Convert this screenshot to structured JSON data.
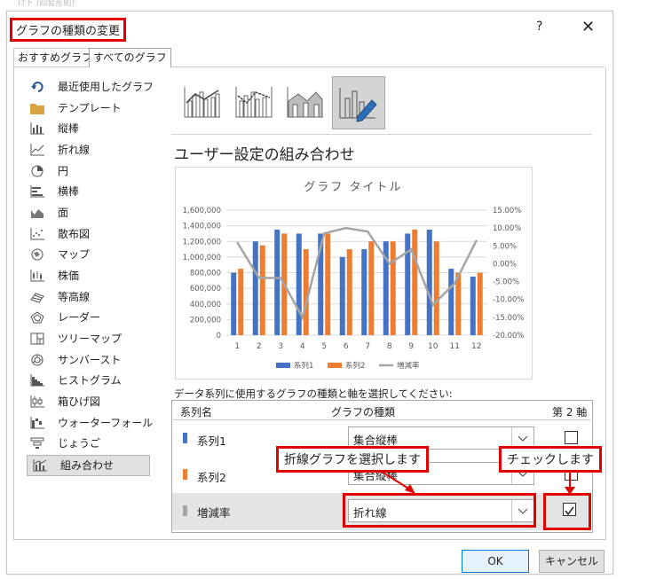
{
  "window": {
    "title": "グラフの種類の変更",
    "help": "?",
    "close": "✕"
  },
  "tabs": [
    {
      "label": "おすすめグラフ"
    },
    {
      "label": "すべてのグラフ"
    }
  ],
  "sidebar": {
    "items": [
      {
        "label": "最近使用したグラフ",
        "icon": "undo-icon"
      },
      {
        "label": "テンプレート",
        "icon": "folder-icon"
      },
      {
        "label": "縦棒",
        "icon": "column-chart-icon"
      },
      {
        "label": "折れ線",
        "icon": "line-chart-icon"
      },
      {
        "label": "円",
        "icon": "pie-chart-icon"
      },
      {
        "label": "横棒",
        "icon": "bar-chart-icon"
      },
      {
        "label": "面",
        "icon": "area-chart-icon"
      },
      {
        "label": "散布図",
        "icon": "scatter-chart-icon"
      },
      {
        "label": "マップ",
        "icon": "map-chart-icon"
      },
      {
        "label": "株価",
        "icon": "stock-chart-icon"
      },
      {
        "label": "等高線",
        "icon": "surface-chart-icon"
      },
      {
        "label": "レーダー",
        "icon": "radar-chart-icon"
      },
      {
        "label": "ツリーマップ",
        "icon": "treemap-chart-icon"
      },
      {
        "label": "サンバースト",
        "icon": "sunburst-chart-icon"
      },
      {
        "label": "ヒストグラム",
        "icon": "histogram-chart-icon"
      },
      {
        "label": "箱ひげ図",
        "icon": "boxwhisker-chart-icon"
      },
      {
        "label": "ウォーターフォール",
        "icon": "waterfall-chart-icon"
      },
      {
        "label": "じょうご",
        "icon": "funnel-chart-icon"
      },
      {
        "label": "組み合わせ",
        "icon": "combo-chart-icon"
      }
    ],
    "selected_index": 18
  },
  "combo_types": {
    "selected_index": 3
  },
  "preview": {
    "heading": "ユーザー設定の組み合わせ"
  },
  "chart_data": {
    "type": "bar",
    "title": "グラフ タイトル",
    "categories": [
      "1",
      "2",
      "3",
      "4",
      "5",
      "6",
      "7",
      "8",
      "9",
      "10",
      "11",
      "12"
    ],
    "series": [
      {
        "name": "系列1",
        "type": "bar",
        "axis": "primary",
        "color": "#4472c4",
        "values": [
          800000,
          1200000,
          1350000,
          1300000,
          1300000,
          1000000,
          1100000,
          1200000,
          1300000,
          1350000,
          850000,
          750000
        ]
      },
      {
        "name": "系列2",
        "type": "bar",
        "axis": "primary",
        "color": "#ed7d31",
        "values": [
          850000,
          1150000,
          1300000,
          1100000,
          1300000,
          1100000,
          1200000,
          1200000,
          1350000,
          1200000,
          800000,
          800000
        ]
      },
      {
        "name": "増減率",
        "type": "line",
        "axis": "secondary",
        "color": "#a5a5a5",
        "values": [
          6.0,
          -4.0,
          -4.0,
          -15.0,
          8.5,
          10.0,
          9.0,
          0.0,
          4.0,
          -11.5,
          -5.5,
          6.5
        ]
      }
    ],
    "y_ticks": [
      "1,600,000",
      "1,400,000",
      "1,200,000",
      "1,000,000",
      "800,000",
      "600,000",
      "400,000",
      "200,000",
      "0"
    ],
    "y2_ticks": [
      "15.00%",
      "10.00%",
      "5.00%",
      "0.00%",
      "-5.00%",
      "-10.00%",
      "-15.00%",
      "-20.00%"
    ],
    "ylim": [
      0,
      1600000
    ],
    "y2lim": [
      -20,
      15
    ],
    "grid": true,
    "legend": "bottom"
  },
  "series_table": {
    "instruction": "データ系列に使用するグラフの種類と軸を選択してください:",
    "headers": {
      "name": "系列名",
      "type": "グラフの種類",
      "axis": "第 2 軸"
    },
    "rows": [
      {
        "name": "系列1",
        "type": "集合縦棒",
        "secondary": false,
        "color": "#4472c4"
      },
      {
        "name": "系列2",
        "type": "集合縦棒",
        "secondary": false,
        "color": "#ed7d31"
      },
      {
        "name": "増減率",
        "type": "折れ線",
        "secondary": true,
        "color": "#a5a5a5"
      }
    ]
  },
  "callouts": {
    "line": "折線グラフを選択します",
    "check": "チェックします"
  },
  "buttons": {
    "ok": "OK",
    "cancel": "キャンセル"
  },
  "background": {
    "cut_text": "けト (四会形則)"
  }
}
